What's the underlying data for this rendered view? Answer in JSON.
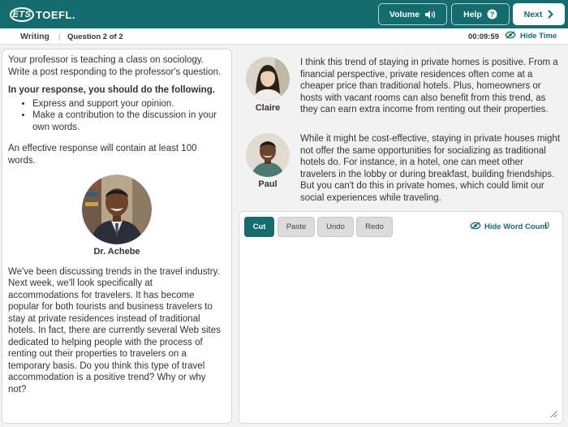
{
  "header": {
    "logo_ets": "ETS",
    "logo_toefl": "TOEFL.",
    "volume_label": "Volume",
    "help_label": "Help",
    "next_label": "Next"
  },
  "subheader": {
    "section": "Writing",
    "separator": "|",
    "question": "Question 2 of 2",
    "timer": "00:09:59",
    "hide_time_label": "Hide Time"
  },
  "prompt": {
    "intro": "Your professor is teaching a class on sociology. Write a post responding to the professor's question.",
    "instructions_heading": "In your response, you should do the following.",
    "bullets": [
      "Express and support your opinion.",
      "Make a contribution to the discussion in your own words."
    ],
    "effective": "An effective response will contain at least 100 words.",
    "professor_name": "Dr. Achebe",
    "professor_text": "We've been discussing trends in the travel industry. Next week, we'll look specifically at accommodations for travelers. It has become popular for both tourists and business travelers to stay at private residences instead of traditional hotels. In fact, there are currently several Web sites dedicated to helping people with the process of renting out their properties to travelers on a temporary basis. Do you think this type of travel accommodation is a positive trend? Why or why not?"
  },
  "posts": [
    {
      "name": "Claire",
      "text": "I think this trend of staying in private homes is positive. From a financial perspective, private residences often come at a cheaper price than traditional hotels. Plus, homeowners or hosts with vacant rooms can also benefit from this trend, as they can earn extra income from renting out their properties."
    },
    {
      "name": "Paul",
      "text": "While it might be cost-effective, staying in private houses might not offer the same opportunities for socializing as traditional hotels do. For instance, in a hotel, one can meet other travelers in the lobby or during breakfast, building friendships. But you can't do this in private homes, which could limit our social experiences while traveling."
    }
  ],
  "editor": {
    "cut_label": "Cut",
    "paste_label": "Paste",
    "undo_label": "Undo",
    "redo_label": "Redo",
    "hide_word_count_label": "Hide Word Count",
    "word_count": "0",
    "response_text": ""
  },
  "colors": {
    "primary_teal": "#146c6e",
    "background": "#f2f2f2"
  }
}
